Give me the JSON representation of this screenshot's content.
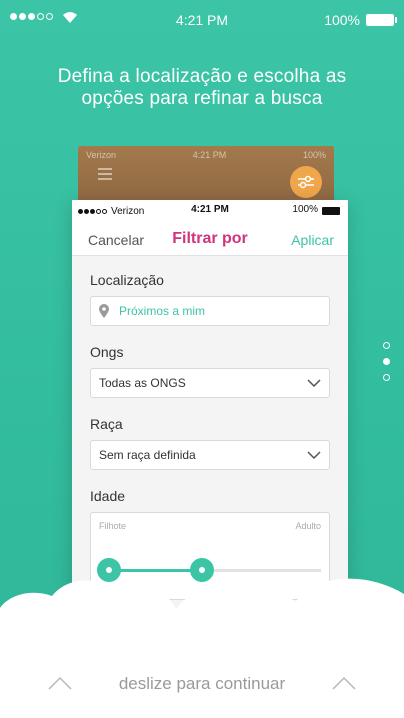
{
  "status_bar": {
    "time": "4:21 PM",
    "battery": "100%"
  },
  "headline": "Defina a localização e escolha as opções para refinar a busca",
  "back_card": {
    "carrier": "Verizon",
    "time": "4:21 PM",
    "battery": "100%"
  },
  "phone": {
    "status": {
      "carrier": "Verizon",
      "time": "4:21 PM",
      "battery": "100%"
    },
    "nav": {
      "cancel": "Cancelar",
      "title": "Filtrar por",
      "apply": "Aplicar"
    },
    "location": {
      "label": "Localização",
      "value": "Próximos a mim"
    },
    "ongs": {
      "label": "Ongs",
      "value": "Todas as ONGS"
    },
    "breed": {
      "label": "Raça",
      "value": "Sem raça definida"
    },
    "age": {
      "label": "Idade",
      "min_label": "Filhote",
      "max_label": "Adulto",
      "range_low": 0.0,
      "range_high": 0.44
    },
    "partial_label": "te"
  },
  "pager": {
    "count": 3,
    "active": 1
  },
  "footer": {
    "swipe_text": "deslize para continuar"
  },
  "colors": {
    "accent": "#3cc4a6",
    "title": "#d0347c",
    "card_back": "#9a7146",
    "filter_button": "#f0a64a"
  }
}
